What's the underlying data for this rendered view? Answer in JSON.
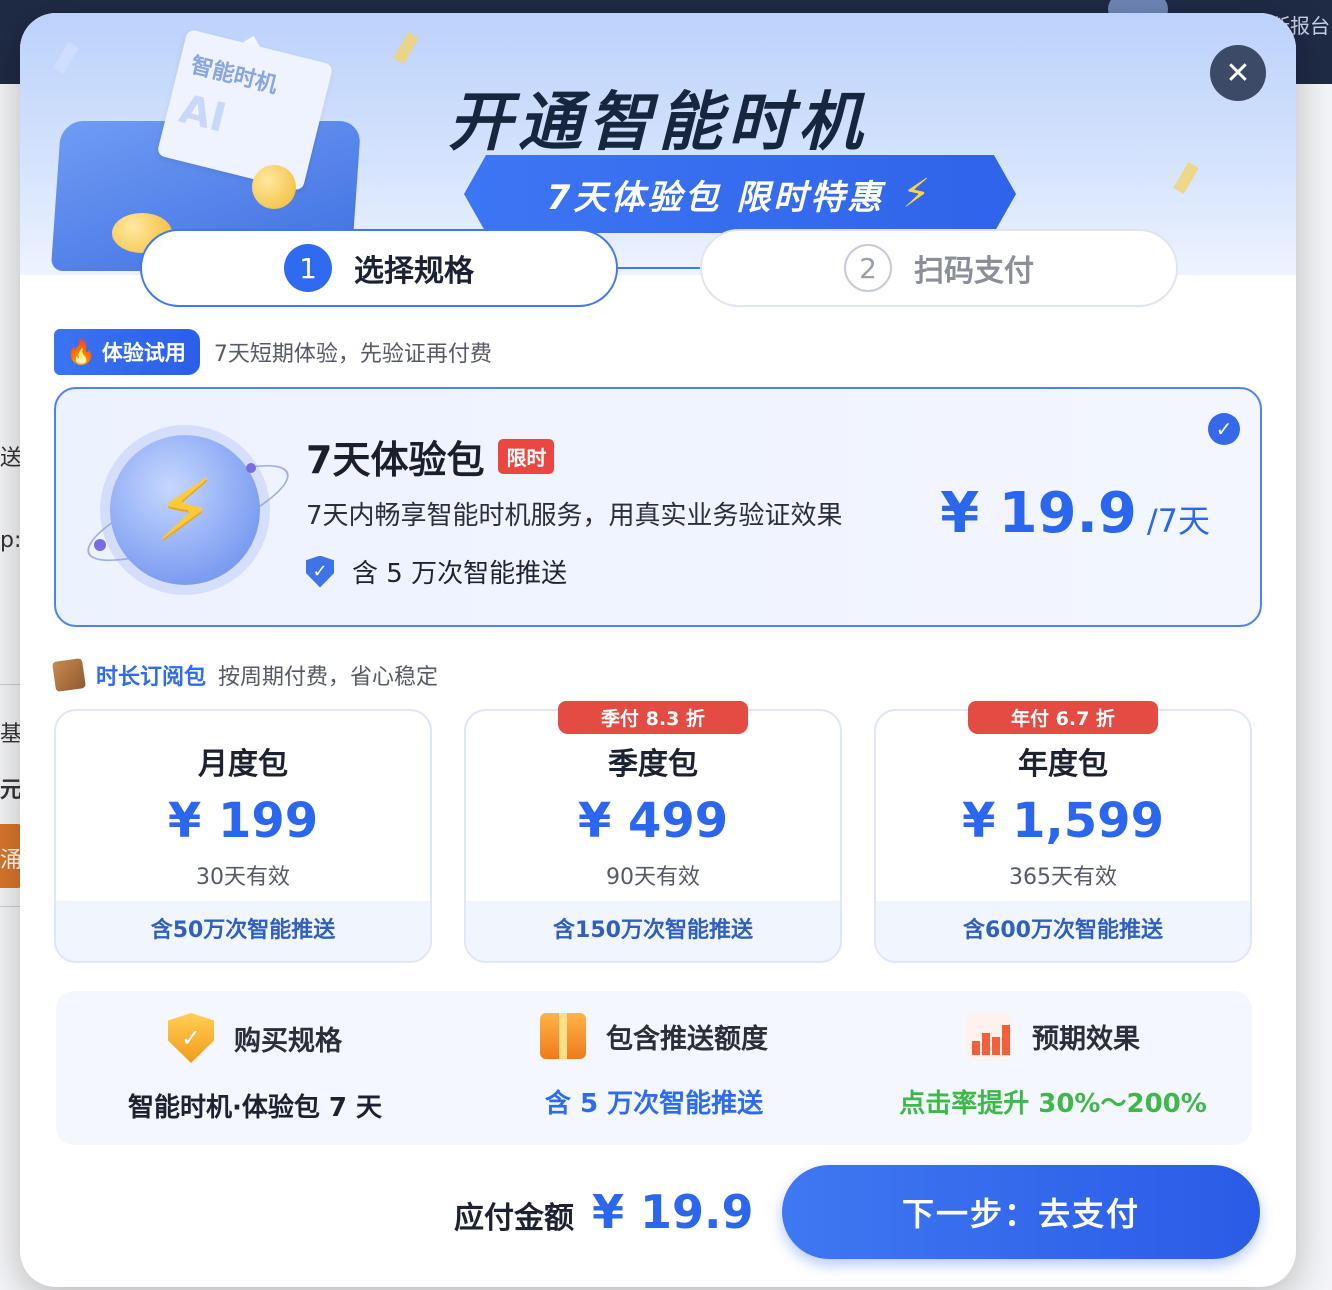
{
  "background": {
    "report_fragment": "断报台",
    "side_fragments": [
      "送",
      "p:",
      "基于",
      "元",
      "涌"
    ]
  },
  "modal": {
    "close_icon": "close-icon",
    "hero": {
      "title": "开通智能时机",
      "ribbon": "7天体验包 限时特惠",
      "paper_text": "智能时机",
      "paper_ai": "AI"
    },
    "steps": [
      {
        "num": "1",
        "label": "选择规格",
        "active": true
      },
      {
        "num": "2",
        "label": "扫码支付",
        "active": false
      }
    ],
    "trial": {
      "badge": "体验试用",
      "desc": "7天短期体验，先验证再付费",
      "card": {
        "name": "7天体验包",
        "tag": "限时",
        "desc": "7天内畅享智能时机服务，用真实业务验证效果",
        "include": "含 5 万次智能推送",
        "price": "¥ 19.9",
        "unit": "/7天",
        "selected": true
      }
    },
    "subscription": {
      "title": "时长订阅包",
      "desc": "按周期付费，省心稳定",
      "plans": [
        {
          "name": "月度包",
          "price": "¥ 199",
          "valid": "30天有效",
          "include": "含50万次智能推送",
          "tag": ""
        },
        {
          "name": "季度包",
          "price": "¥ 499",
          "valid": "90天有效",
          "include": "含150万次智能推送",
          "tag": "季付 8.3 折"
        },
        {
          "name": "年度包",
          "price": "¥ 1,599",
          "valid": "365天有效",
          "include": "含600万次智能推送",
          "tag": "年付 6.7 折"
        }
      ]
    },
    "summary": [
      {
        "label": "购买规格",
        "value": "智能时机·体验包 7 天",
        "icon": "shield-check-icon",
        "color": "#1d2230"
      },
      {
        "label": "包含推送额度",
        "value": "含 5 万次智能推送",
        "icon": "gift-icon",
        "color": "#2f6bf0"
      },
      {
        "label": "预期效果",
        "value": "点击率提升 30%～200%",
        "icon": "chart-up-icon",
        "color": "#3fb84a"
      }
    ],
    "footer": {
      "total_label": "应付金额",
      "total_amount": "¥ 19.9",
      "next_button": "下一步：去支付"
    }
  }
}
